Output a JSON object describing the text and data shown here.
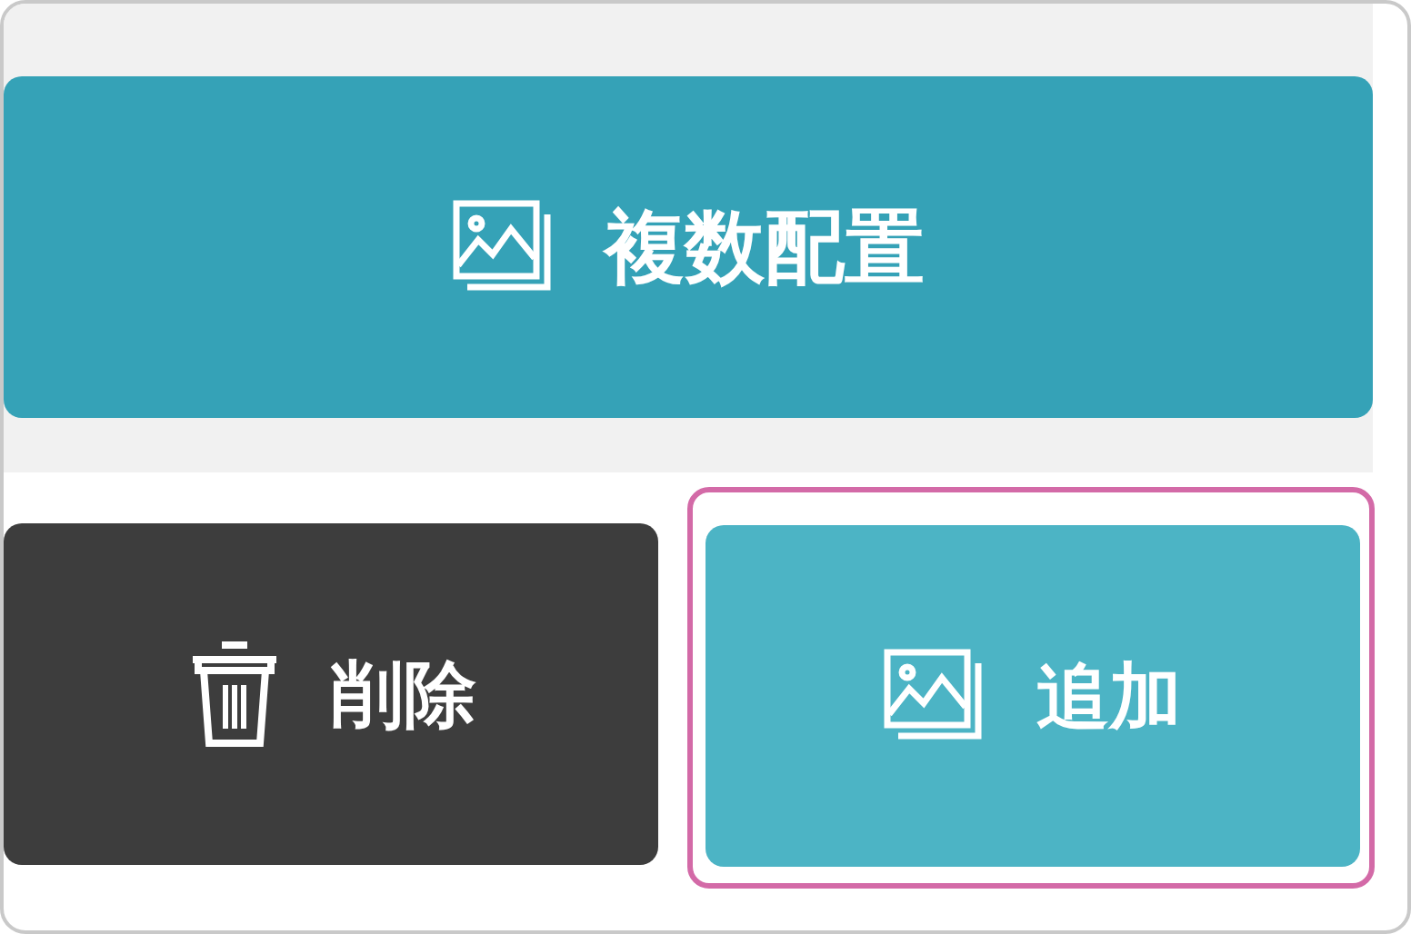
{
  "top_button": {
    "label": "複数配置",
    "kind": "primary"
  },
  "bottom_buttons": [
    {
      "label": "削除",
      "kind": "dark",
      "highlighted": false
    },
    {
      "label": "追加",
      "kind": "light",
      "highlighted": true
    }
  ]
}
